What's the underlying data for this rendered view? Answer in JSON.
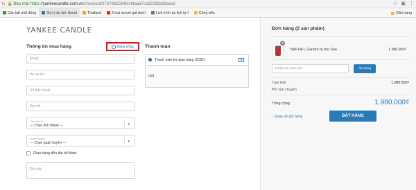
{
  "browser": {
    "secure_label": "Bảo mật",
    "url_scheme": "https://",
    "url_host": "yankeecandle.com.vn",
    "url_path": "/checkout/27678b22648c4daaa7ca92339a69aec6"
  },
  "bookmarks": [
    {
      "label": "Các tab mới đóng",
      "color": "#4a8a4a"
    },
    {
      "label": "Gợi ý du lịch Seoul",
      "color": "#2a7ab8"
    },
    {
      "label": "Thailand",
      "color": "#e8a72c"
    },
    {
      "label": "3 loại serum giá dưới",
      "color": "#d2321f"
    },
    {
      "label": "Lịch trình du lịch tự t",
      "color": "#777777"
    },
    {
      "label": "Công việc",
      "color": "#e8c23c"
    }
  ],
  "bookmarks_right": "Dấu trang",
  "logo": "YANKEE CANDLE",
  "buyer": {
    "title": "Thông tin mua hàng",
    "login_label": "Đăng nhập",
    "email_placeholder": "Email",
    "name_placeholder": "Họ và tên",
    "phone_placeholder": "Số điện thoại",
    "address_placeholder": "Địa chỉ",
    "province_label": "Tỉnh thành",
    "province_value": "--- Chọn tỉnh thành ---",
    "district_label": "Quận huyện",
    "district_value": "--- Chọn quận huyện ---",
    "other_address_label": "Giao hàng đến địa chỉ khác",
    "notes_placeholder": "Ghi chú"
  },
  "payment": {
    "title": "Thanh toán",
    "method": "Thanh toán khi giao hàng (COD)",
    "description": "cod"
  },
  "order": {
    "title": "Đơn hàng (2 sản phẩm)",
    "product_qty": "2",
    "product_name": "Nến Hũ L Garden by the Sea",
    "product_price": "1.980.000₫",
    "discount_placeholder": "Nhập mã giảm giá",
    "apply_label": "Áp dụng",
    "subtotal_label": "Tạm tính",
    "subtotal_value": "1.980.000₫",
    "shipping_label": "Phí vận chuyển",
    "total_label": "Tổng cộng",
    "total_value": "1.980.000₫",
    "back_label": "Quay về giỏ hàng",
    "order_button": "ĐẶT HÀNG"
  },
  "colors": {
    "accent": "#2a7ab8",
    "highlight_border": "#e2111c"
  }
}
